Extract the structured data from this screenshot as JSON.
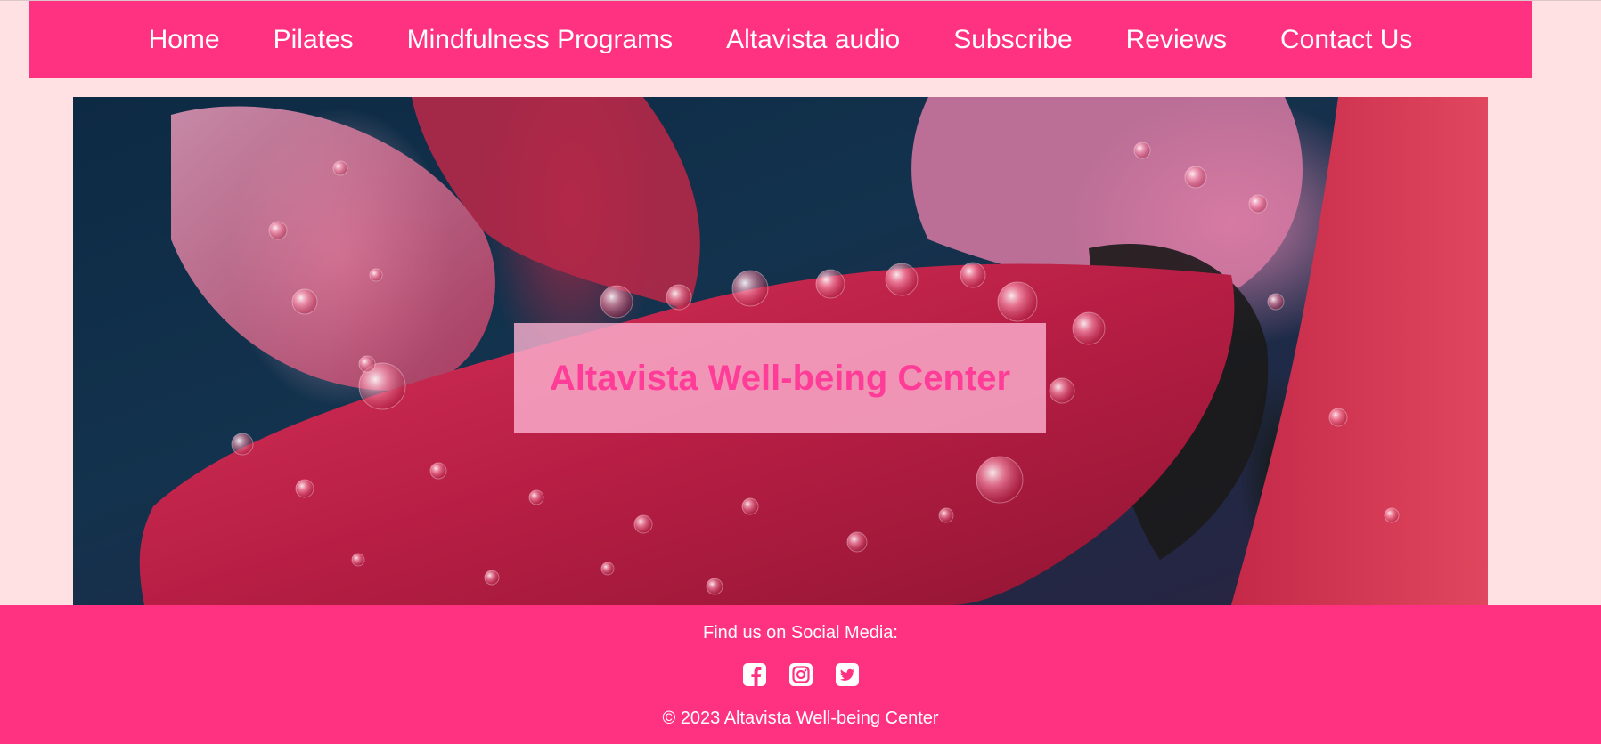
{
  "nav": {
    "items": [
      {
        "label": "Home"
      },
      {
        "label": "Pilates"
      },
      {
        "label": "Mindfulness Programs"
      },
      {
        "label": "Altavista audio"
      },
      {
        "label": "Subscribe"
      },
      {
        "label": "Reviews"
      },
      {
        "label": "Contact Us"
      }
    ]
  },
  "hero": {
    "title": "Altavista Well-being Center"
  },
  "footer": {
    "social_heading": "Find us on Social Media:",
    "social_icons": [
      "facebook-icon",
      "instagram-icon",
      "twitter-icon"
    ],
    "copyright": "© 2023 Altavista Well-being Center"
  },
  "colors": {
    "page_background": "#ffe0e3",
    "brand_pink": "#ff3282",
    "title_pink": "#ff3d98",
    "title_box": "#ffb6d5"
  }
}
